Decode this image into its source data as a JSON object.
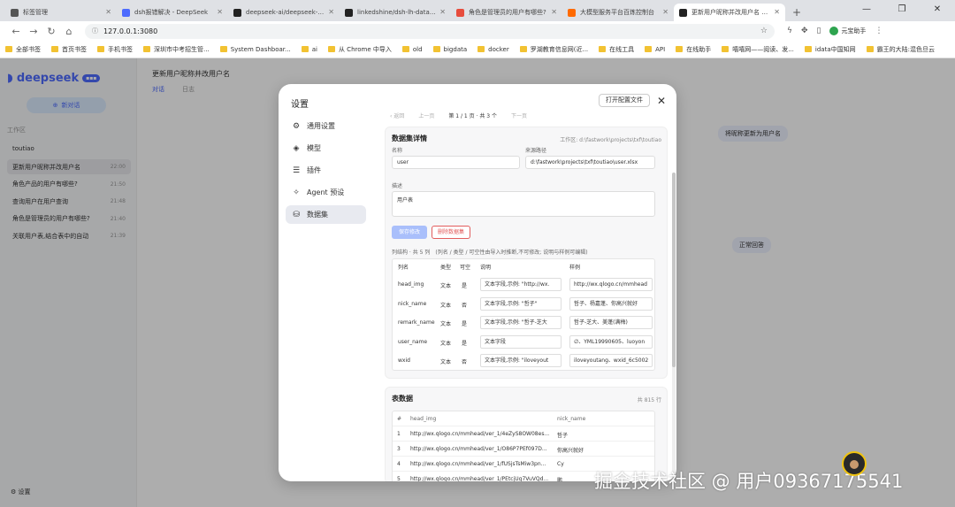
{
  "browser": {
    "tabs": [
      {
        "label": "标签管理",
        "color": "#555555",
        "active": false
      },
      {
        "label": "dsh报错解决 - DeepSeek",
        "color": "#4d6bfe",
        "active": false
      },
      {
        "label": "deepseek-ai/deepseek-harness",
        "color": "#222222",
        "active": false
      },
      {
        "label": "linkedshine/dsh-lh-data: agenti",
        "color": "#222222",
        "active": false
      },
      {
        "label": "角色是管理员的用户有哪些?",
        "color": "#e74c3c",
        "active": false
      },
      {
        "label": "大模型服务平台百炼控制台",
        "color": "#ff6a00",
        "active": false
      },
      {
        "label": "更新用户昵称并改用户名 — Dee",
        "color": "#222222",
        "active": true
      }
    ],
    "address": "127.0.0.1:3080",
    "extension_label": "元宝助手",
    "bookmarks": [
      "全部书签",
      "首页书签",
      "手机书签",
      "深圳市中考招生管...",
      "System Dashboar...",
      "ai",
      "从 Chrome 中导入",
      "old",
      "bigdata",
      "docker",
      "罗湖教育信息网(近...",
      "在线工具",
      "API",
      "在线助手",
      "嘻嘻网——阅读、发...",
      "idata中国知网",
      "霸王的大陆:混色旦云"
    ]
  },
  "app": {
    "brand": "deepseek",
    "new_chat": "新对话",
    "workspace": "工作区",
    "project": "toutiao",
    "conversations": [
      {
        "title": "更新用户昵称并改用户名",
        "time": "22:00",
        "selected": true
      },
      {
        "title": "角色产品的用户有哪些?",
        "time": "21:50",
        "selected": false
      },
      {
        "title": "查询用户在用户查询",
        "time": "21:48",
        "selected": false
      },
      {
        "title": "角色是管理员的用户有哪些?",
        "time": "21:40",
        "selected": false
      },
      {
        "title": "关联用户表,结合表中的自动",
        "time": "21:39",
        "selected": false
      }
    ],
    "settings_label": "设置",
    "header_title": "更新用户昵称并改用户名",
    "header_tabs": [
      "对话",
      "日志"
    ],
    "bubbles": [
      {
        "text": "将昵称更新为用户名"
      },
      {
        "text": "正常回答"
      }
    ]
  },
  "modal": {
    "title": "设置",
    "open_config": "打开配置文件",
    "nav": [
      {
        "label": "通用设置",
        "icon": "gear-icon",
        "glyph": "⚙",
        "active": false
      },
      {
        "label": "模型",
        "icon": "cube-icon",
        "glyph": "◈",
        "active": false
      },
      {
        "label": "插件",
        "icon": "sliders-icon",
        "glyph": "☰",
        "active": false
      },
      {
        "label": "Agent 预设",
        "icon": "puzzle-icon",
        "glyph": "✧",
        "active": false
      },
      {
        "label": "数据集",
        "icon": "database-icon",
        "glyph": "⛁",
        "active": true
      }
    ],
    "pager": {
      "back": "‹ 返回",
      "prev": "上一页",
      "current": "第 1 / 1 页 · 共 3 个",
      "next": "下一页"
    },
    "dataset": {
      "section_title": "数据集详情",
      "workspace": "工作区: d:\\fastwork\\projects\\txf\\toutiao",
      "name_label": "名称",
      "name_value": "user",
      "source_label": "来源路径",
      "source_value": "d:\\fastwork\\projects\\txf\\toutiao\\user.xlsx",
      "desc_label": "描述",
      "desc_value": "用户表",
      "save_label": "保存修改",
      "delete_label": "删除数据集",
      "columns_count": "列结构 · 共 5 列",
      "columns_hint": "(列名 / 类型 / 可空性由导入时推断,不可修改; 说明与样例可编辑)",
      "column_headers": [
        "列名",
        "类型",
        "可空",
        "说明",
        "样例"
      ],
      "columns": [
        {
          "name": "head_img",
          "type": "文本",
          "nullable": "是",
          "desc": "文本字段,示例: \"http://wx.",
          "sample": "http://wx.qlogo.cn/mmhead"
        },
        {
          "name": "nick_name",
          "type": "文本",
          "nullable": "否",
          "desc": "文本字段,示例: \"哲子\"",
          "sample": "哲子、杨嘉蓬、你高兴就好"
        },
        {
          "name": "remark_name",
          "type": "文本",
          "nullable": "是",
          "desc": "文本字段,示例: \"哲子-芝大",
          "sample": "哲子-芝大、美蓬(满梅)"
        },
        {
          "name": "user_name",
          "type": "文本",
          "nullable": "是",
          "desc": "文本字段",
          "sample": "∅、YML19990605、luoyon"
        },
        {
          "name": "wxid",
          "type": "文本",
          "nullable": "否",
          "desc": "文本字段,示例: \"iloveyout",
          "sample": "iloveyoutang、wxid_6c5002"
        }
      ]
    },
    "table": {
      "title": "表数据",
      "count": "共 815 行",
      "headers": [
        "#",
        "head_img",
        "nick_name"
      ],
      "rows": [
        {
          "n": "1",
          "head_img": "http://wx.qlogo.cn/mmhead/ver_1/4eZyS8OW08es...",
          "nick_name": "哲子"
        },
        {
          "n": "3",
          "head_img": "http://wx.qlogo.cn/mmhead/ver_1/O86P7PEf097D...",
          "nick_name": "你高兴就好"
        },
        {
          "n": "4",
          "head_img": "http://wx.qlogo.cn/mmhead/ver_1/fUSjsTsMiw3pn...",
          "nick_name": "Cy"
        },
        {
          "n": "5",
          "head_img": "http://wx.qlogo.cn/mmhead/ver_1/PEtcjUg7VuVQd...",
          "nick_name": "鹏"
        }
      ]
    }
  },
  "watermark": "掘金技术社区 @ 用户0936717554​1"
}
